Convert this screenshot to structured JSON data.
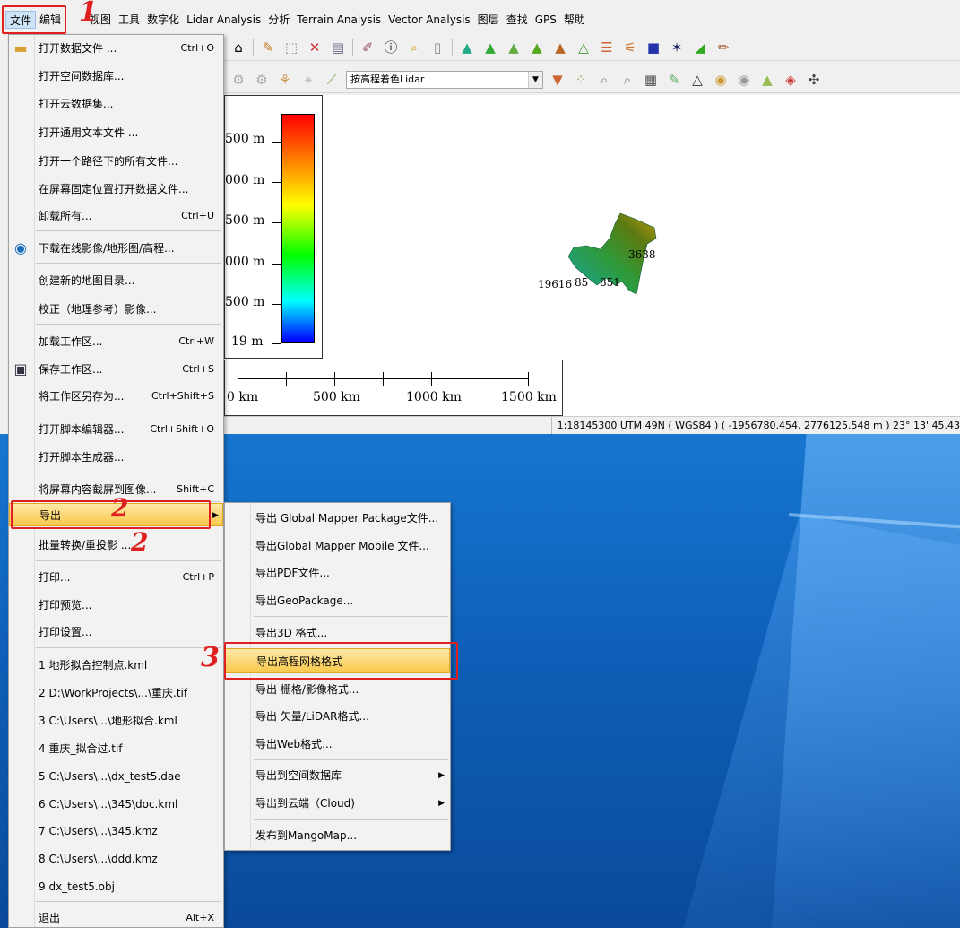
{
  "menubar": [
    "文件",
    "编辑",
    "视图",
    "工具",
    "数字化",
    "Lidar Analysis",
    "分析",
    "Terrain Analysis",
    "Vector Analysis",
    "图层",
    "查找",
    "GPS",
    "帮助"
  ],
  "toolbar": {
    "lidar_select": "按高程着色Lidar"
  },
  "legend": {
    "labels": [
      "500 m",
      "000 m",
      "500 m",
      "000 m",
      "500 m",
      "19 m"
    ]
  },
  "scale": {
    "labels": [
      "0 km",
      "500 km",
      "1000 km",
      "1500 km"
    ]
  },
  "map_labels": [
    "3638",
    "19616",
    "85",
    "851"
  ],
  "status": "1:18145300 UTM 49N ( WGS84 ) ( -1956780.454, 2776125.548 m ) 23° 13' 45.43",
  "file_menu": [
    {
      "label": "打开数据文件 ...",
      "shortcut": "Ctrl+O",
      "icon": "folder-icon"
    },
    {
      "label": "打开空间数据库...",
      "shortcut": ""
    },
    {
      "label": "打开云数据集...",
      "shortcut": ""
    },
    {
      "label": "打开通用文本文件 ...",
      "shortcut": ""
    },
    {
      "label": "打开一个路径下的所有文件...",
      "shortcut": ""
    },
    {
      "label": "在屏幕固定位置打开数据文件...",
      "shortcut": ""
    },
    {
      "label": "卸载所有...",
      "shortcut": "Ctrl+U"
    },
    {
      "label": "下载在线影像/地形图/高程...",
      "shortcut": "",
      "icon": "globe-icon"
    },
    {
      "label": "创建新的地图目录...",
      "shortcut": ""
    },
    {
      "label": "校正（地理参考）影像...",
      "shortcut": ""
    },
    {
      "label": "加载工作区...",
      "shortcut": "Ctrl+W"
    },
    {
      "label": "保存工作区...",
      "shortcut": "Ctrl+S",
      "icon": "save-icon"
    },
    {
      "label": "将工作区另存为...",
      "shortcut": "Ctrl+Shift+S"
    },
    {
      "label": "打开脚本编辑器...",
      "shortcut": "Ctrl+Shift+O"
    },
    {
      "label": "打开脚本生成器...",
      "shortcut": ""
    },
    {
      "label": "将屏幕内容截屏到图像...",
      "shortcut": "Shift+C"
    },
    {
      "label": "导出",
      "shortcut": "",
      "submenu": true
    },
    {
      "label": "批量转换/重投影 ...",
      "shortcut": ""
    },
    {
      "label": "打印...",
      "shortcut": "Ctrl+P"
    },
    {
      "label": "打印预览...",
      "shortcut": ""
    },
    {
      "label": "打印设置...",
      "shortcut": ""
    },
    {
      "label": "1 地形拟合控制点.kml",
      "shortcut": ""
    },
    {
      "label": "2 D:\\WorkProjects\\...\\重庆.tif",
      "shortcut": ""
    },
    {
      "label": "3 C:\\Users\\...\\地形拟合.kml",
      "shortcut": ""
    },
    {
      "label": "4 重庆_拟合过.tif",
      "shortcut": ""
    },
    {
      "label": "5 C:\\Users\\...\\dx_test5.dae",
      "shortcut": ""
    },
    {
      "label": "6 C:\\Users\\...\\345\\doc.kml",
      "shortcut": ""
    },
    {
      "label": "7 C:\\Users\\...\\345.kmz",
      "shortcut": ""
    },
    {
      "label": "8 C:\\Users\\...\\ddd.kmz",
      "shortcut": ""
    },
    {
      "label": "9 dx_test5.obj",
      "shortcut": ""
    },
    {
      "label": "退出",
      "shortcut": "Alt+X"
    }
  ],
  "export_menu": [
    {
      "label": "导出 Global Mapper Package文件..."
    },
    {
      "label": "导出Global Mapper Mobile 文件..."
    },
    {
      "label": "导出PDF文件..."
    },
    {
      "label": "导出GeoPackage..."
    },
    {
      "label": "导出3D 格式..."
    },
    {
      "label": "导出高程网格格式"
    },
    {
      "label": "导出 栅格/影像格式..."
    },
    {
      "label": "导出 矢量/LiDAR格式..."
    },
    {
      "label": "导出Web格式..."
    },
    {
      "label": "导出到空间数据库",
      "submenu": true
    },
    {
      "label": "导出到云端（Cloud)",
      "submenu": true
    },
    {
      "label": "发布到MangoMap..."
    }
  ],
  "annotations": [
    "1",
    "2",
    "2",
    "3"
  ]
}
